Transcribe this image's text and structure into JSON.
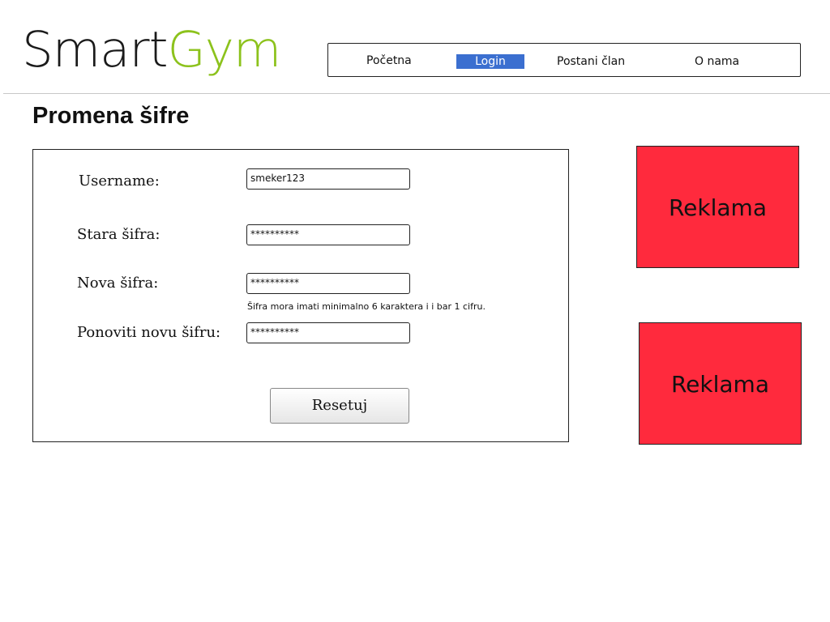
{
  "logo": {
    "part1": "Smart",
    "part2": "Gym"
  },
  "nav": {
    "items": [
      {
        "label": "Početna"
      },
      {
        "label": "Login",
        "active": true
      },
      {
        "label": "Postani član"
      },
      {
        "label": "O nama"
      }
    ]
  },
  "page": {
    "title": "Promena šifre"
  },
  "form": {
    "username_label": "Username:",
    "username_value": "smeker123",
    "old_password_label": "Stara šifra:",
    "old_password_value": "**********",
    "new_password_label": "Nova šifra:",
    "new_password_value": "**********",
    "password_hint": "Šifra mora imati minimalno 6 karaktera i i bar 1 cifru.",
    "repeat_password_label": "Ponoviti novu šifru:",
    "repeat_password_value": "**********",
    "reset_button": "Resetuj"
  },
  "ads": [
    {
      "label": "Reklama"
    },
    {
      "label": "Reklama"
    }
  ],
  "colors": {
    "brand_dark": "#1a1a1a",
    "brand_green": "#8cc21c",
    "nav_active": "#3b6fd0",
    "ad_background": "#ff2a3d"
  }
}
